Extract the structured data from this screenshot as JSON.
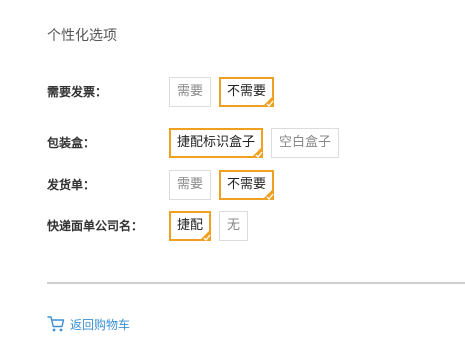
{
  "section_title": "个性化选项",
  "options": [
    {
      "label": "需要发票：",
      "choices": [
        {
          "label": "需要",
          "selected": false
        },
        {
          "label": "不需要",
          "selected": true
        }
      ]
    },
    {
      "label": "包装盒：",
      "choices": [
        {
          "label": "捷配标识盒子",
          "selected": true
        },
        {
          "label": "空白盒子",
          "selected": false
        }
      ]
    },
    {
      "label": "发货单：",
      "choices": [
        {
          "label": "需要",
          "selected": false
        },
        {
          "label": "不需要",
          "selected": true
        }
      ]
    },
    {
      "label": "快递面单公司名：",
      "choices": [
        {
          "label": "捷配",
          "selected": true
        },
        {
          "label": "无",
          "selected": false
        }
      ]
    }
  ],
  "back_link": {
    "label": "返回购物车",
    "icon": "cart-icon"
  },
  "colors": {
    "selected_border": "#f0a020",
    "link": "#3b8fd4",
    "unselected_border": "#dcdcdc"
  }
}
